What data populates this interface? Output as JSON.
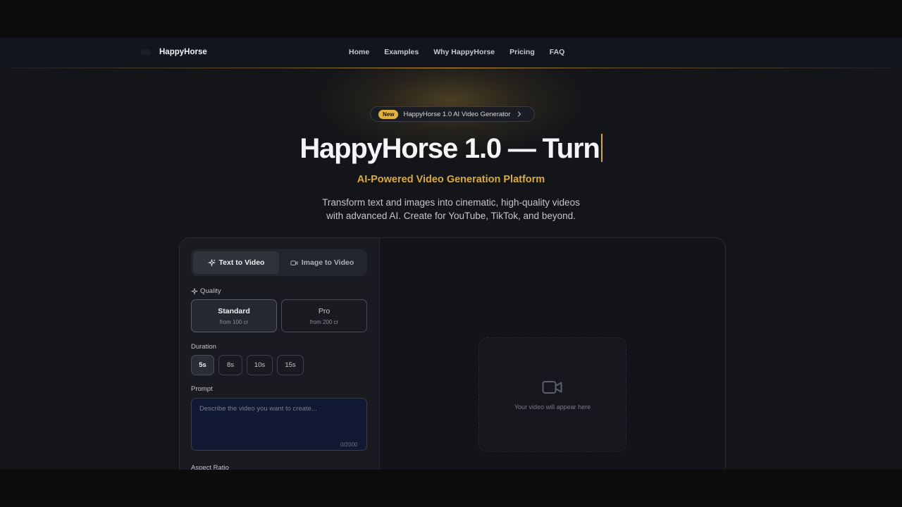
{
  "navbar": {
    "brand": "HappyHorse",
    "links": [
      "Home",
      "Examples",
      "Why HappyHorse",
      "Pricing",
      "FAQ"
    ]
  },
  "hero": {
    "badge_pill": "New",
    "badge_text": "HappyHorse 1.0 AI Video Generator",
    "title": "HappyHorse 1.0 — Turn",
    "subtitle": "AI-Powered Video Generation Platform",
    "description_line1": "Transform text and images into cinematic, high-quality videos",
    "description_line2": "with advanced AI. Create for YouTube, TikTok, and beyond."
  },
  "generator": {
    "tabs": [
      {
        "label": "Text to Video",
        "active": true
      },
      {
        "label": "Image to Video",
        "active": false
      }
    ],
    "quality_label": "Quality",
    "quality_options": [
      {
        "title": "Standard",
        "subtitle": "from 100 cr",
        "selected": true
      },
      {
        "title": "Pro",
        "subtitle": "from 200 cr",
        "selected": false
      }
    ],
    "duration_label": "Duration",
    "durations": [
      "5s",
      "8s",
      "10s",
      "15s"
    ],
    "duration_selected": "5s",
    "prompt_label": "Prompt",
    "prompt_placeholder": "Describe the video you want to create...",
    "prompt_value": "",
    "prompt_counter": "0/2000",
    "aspect_label": "Aspect Ratio",
    "preview_text": "Your video will appear here"
  },
  "colors": {
    "accent": "#d9aa3e",
    "background": "#141519",
    "panel": "#1a1b21"
  }
}
